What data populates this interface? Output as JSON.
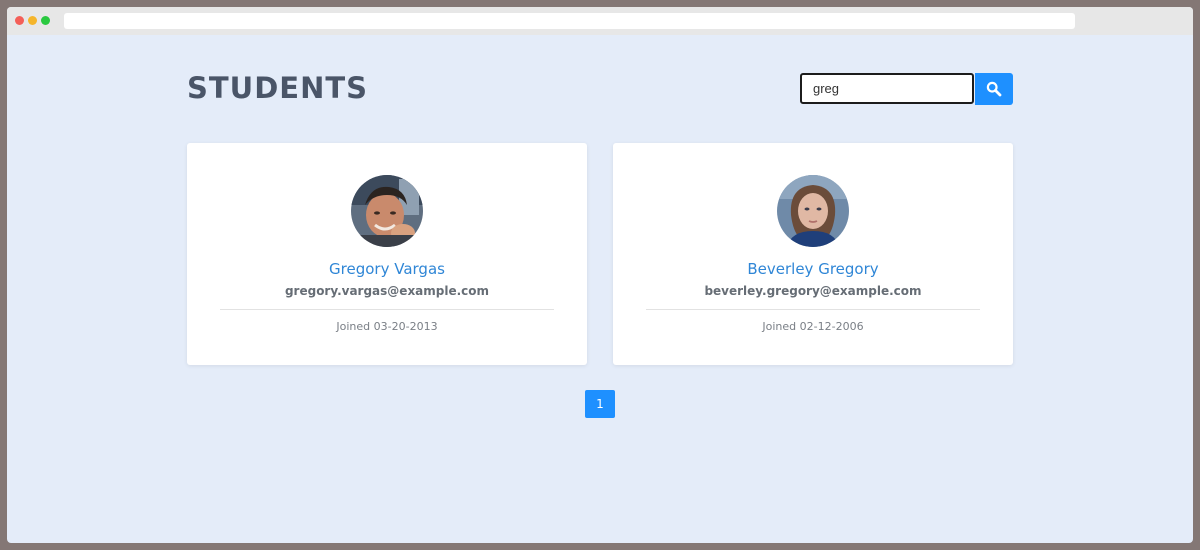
{
  "page": {
    "title": "STUDENTS"
  },
  "search": {
    "value": "greg",
    "icon": "search-icon"
  },
  "students": [
    {
      "name": "Gregory Vargas",
      "email": "gregory.vargas@example.com",
      "joined": "Joined 03-20-2013"
    },
    {
      "name": "Beverley Gregory",
      "email": "beverley.gregory@example.com",
      "joined": "Joined 02-12-2006"
    }
  ],
  "pagination": {
    "current": "1"
  },
  "colors": {
    "accent": "#1e90ff",
    "name_text": "#2f86d6",
    "title_text": "#4a5568",
    "background": "#e4ecf9"
  }
}
